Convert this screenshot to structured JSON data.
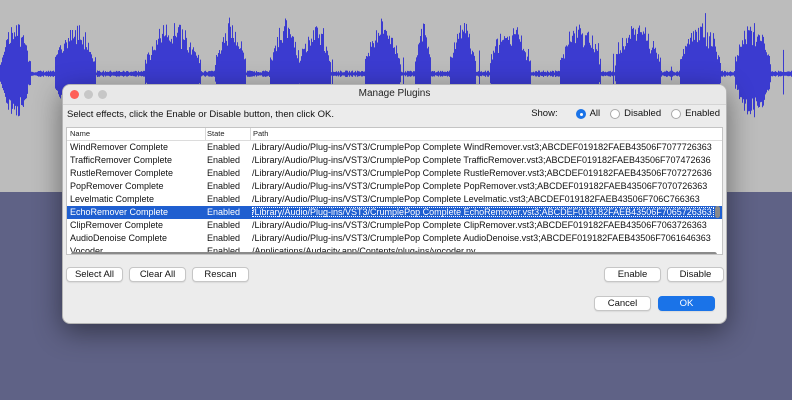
{
  "dialog": {
    "title": "Manage Plugins",
    "instructions": "Select effects, click the Enable or Disable button, then click OK.",
    "show": {
      "label": "Show:",
      "options": [
        {
          "label": "All",
          "selected": true
        },
        {
          "label": "Disabled",
          "selected": false
        },
        {
          "label": "Enabled",
          "selected": false
        }
      ]
    },
    "columns": {
      "name": "Name",
      "state": "State",
      "path": "Path"
    },
    "rows": [
      {
        "name": "WindRemover Complete",
        "state": "Enabled",
        "path": "/Library/Audio/Plug-ins/VST3/CrumplePop Complete WindRemover.vst3;ABCDEF019182FAEB43506F7077726363",
        "selected": false
      },
      {
        "name": "TrafficRemover Complete",
        "state": "Enabled",
        "path": "/Library/Audio/Plug-ins/VST3/CrumplePop Complete TrafficRemover.vst3;ABCDEF019182FAEB43506F707472636",
        "selected": false
      },
      {
        "name": "RustleRemover Complete",
        "state": "Enabled",
        "path": "/Library/Audio/Plug-ins/VST3/CrumplePop Complete RustleRemover.vst3;ABCDEF019182FAEB43506F707272636",
        "selected": false
      },
      {
        "name": "PopRemover Complete",
        "state": "Enabled",
        "path": "/Library/Audio/Plug-ins/VST3/CrumplePop Complete PopRemover.vst3;ABCDEF019182FAEB43506F7070726363",
        "selected": false
      },
      {
        "name": "Levelmatic Complete",
        "state": "Enabled",
        "path": "/Library/Audio/Plug-ins/VST3/CrumplePop Complete Levelmatic.vst3;ABCDEF019182FAEB43506F706C766363",
        "selected": false
      },
      {
        "name": "EchoRemover Complete",
        "state": "Enabled",
        "path": "/Library/Audio/Plug-ins/VST3/CrumplePop Complete EchoRemover.vst3;ABCDEF019182FAEB43506F7065726363",
        "selected": true
      },
      {
        "name": "ClipRemover Complete",
        "state": "Enabled",
        "path": "/Library/Audio/Plug-ins/VST3/CrumplePop Complete ClipRemover.vst3;ABCDEF019182FAEB43506F7063726363",
        "selected": false
      },
      {
        "name": "AudioDenoise Complete",
        "state": "Enabled",
        "path": "/Library/Audio/Plug-ins/VST3/CrumplePop Complete AudioDenoise.vst3;ABCDEF019182FAEB43506F7061646363",
        "selected": false
      },
      {
        "name": "Vocoder",
        "state": "Enabled",
        "path": "/Applications/Audacity.app/Contents/plug-ins/vocoder.ny",
        "selected": false
      }
    ],
    "buttons": {
      "select_all": "Select All",
      "clear_all": "Clear All",
      "rescan": "Rescan",
      "enable": "Enable",
      "disable": "Disable",
      "cancel": "Cancel",
      "ok": "OK"
    }
  },
  "colors": {
    "waveform": "#3b3bd0",
    "track_background": "#bcbcbc",
    "window_background": "#5f6286",
    "selection": "#1f5fd0",
    "accent": "#1a73e8"
  }
}
